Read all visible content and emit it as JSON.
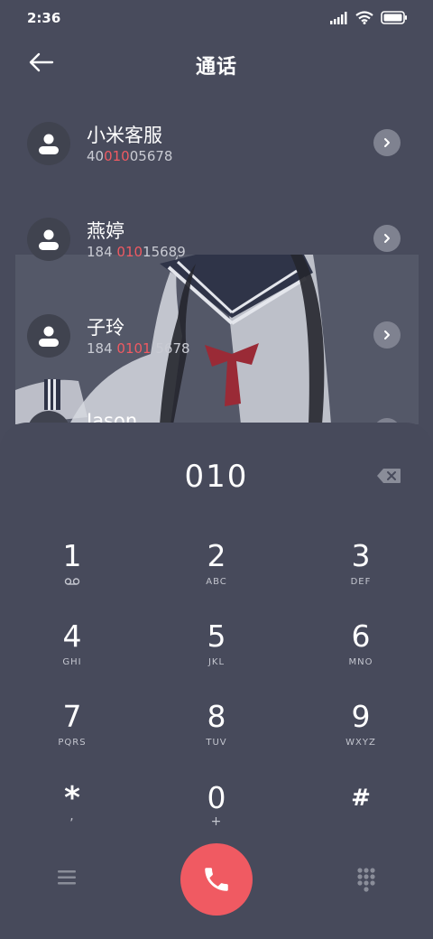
{
  "status": {
    "time": "2:36",
    "icons": [
      "signal-icon",
      "wifi-icon",
      "battery-icon"
    ]
  },
  "header": {
    "title": "通话",
    "back_icon": "arrow-left-icon"
  },
  "contacts": [
    {
      "name": "小米客服",
      "number_parts": [
        "40",
        "010",
        "05678"
      ]
    },
    {
      "name": "燕婷",
      "number_parts": [
        "184 ",
        "010",
        "15689"
      ]
    },
    {
      "name": "子玲",
      "number_parts": [
        "184 ",
        "0101",
        " 5678"
      ]
    },
    {
      "name": "Jason",
      "number_parts": [
        "",
        "",
        ""
      ]
    }
  ],
  "dialer": {
    "input": "010",
    "keys": [
      {
        "digit": "1",
        "sub": "voicemail-icon"
      },
      {
        "digit": "2",
        "sub": "ABC"
      },
      {
        "digit": "3",
        "sub": "DEF"
      },
      {
        "digit": "4",
        "sub": "GHI"
      },
      {
        "digit": "5",
        "sub": "JKL"
      },
      {
        "digit": "6",
        "sub": "MNO"
      },
      {
        "digit": "7",
        "sub": "PQRS"
      },
      {
        "digit": "8",
        "sub": "TUV"
      },
      {
        "digit": "9",
        "sub": "WXYZ"
      },
      {
        "digit": "*",
        "sub": ","
      },
      {
        "digit": "0",
        "sub": "+"
      },
      {
        "digit": "#",
        "sub": ""
      }
    ]
  },
  "colors": {
    "background": "#484b5c",
    "highlight": "#f05a62",
    "call_button": "#f05a62"
  }
}
